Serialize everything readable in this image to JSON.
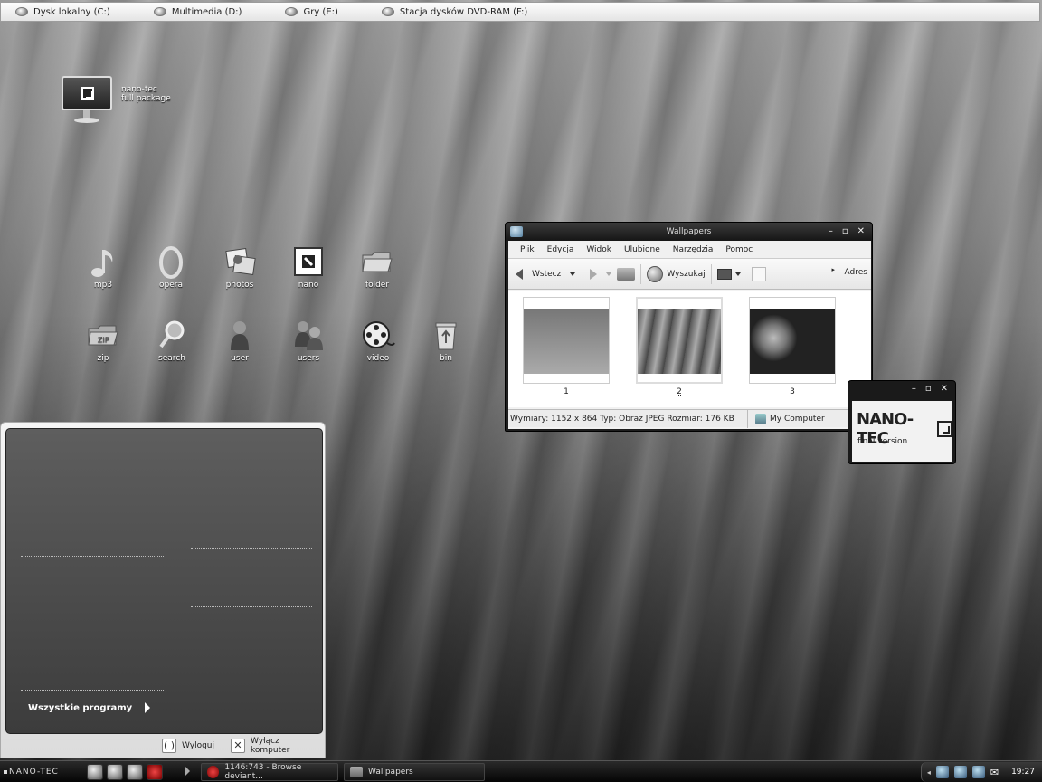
{
  "drives": [
    {
      "label": "Dysk lokalny (C:)"
    },
    {
      "label": "Multimedia (D:)"
    },
    {
      "label": "Gry (E:)"
    },
    {
      "label": "Stacja dysków DVD-RAM (F:)"
    }
  ],
  "desktop": {
    "package": {
      "line1": "nano-tec",
      "line2": "full package"
    },
    "row1": [
      {
        "label": "mp3",
        "icon": "music-note-icon"
      },
      {
        "label": "opera",
        "icon": "opera-icon"
      },
      {
        "label": "photos",
        "icon": "photos-icon"
      },
      {
        "label": "nano",
        "icon": "nano-icon"
      },
      {
        "label": "folder",
        "icon": "folder-icon"
      }
    ],
    "row2": [
      {
        "label": "zip",
        "icon": "zip-folder-icon"
      },
      {
        "label": "search",
        "icon": "search-icon"
      },
      {
        "label": "user",
        "icon": "user-icon"
      },
      {
        "label": "users",
        "icon": "users-icon"
      },
      {
        "label": "video",
        "icon": "film-reel-icon"
      },
      {
        "label": "bin",
        "icon": "recycle-bin-icon"
      }
    ]
  },
  "start_menu": {
    "all_programs": "Wszystkie programy",
    "logoff": "Wyloguj",
    "shutdown": "Wyłącz komputer"
  },
  "explorer": {
    "title": "Wallpapers",
    "menu": [
      "Plik",
      "Edycja",
      "Widok",
      "Ulubione",
      "Narzędzia",
      "Pomoc"
    ],
    "back": "Wstecz",
    "search": "Wyszukaj",
    "address": "Adres",
    "thumbs": [
      {
        "label": "1"
      },
      {
        "label": "2"
      },
      {
        "label": "3"
      }
    ],
    "status": "Wymiary: 1152 x 864 Typ: Obraz JPEG Rozmiar: 176 KB",
    "location": "My Computer"
  },
  "badge": {
    "title": "NANO-TEC",
    "subtitle": "final version"
  },
  "taskbar": {
    "start": "NANO-TEC",
    "tasks": [
      {
        "label": "1146:743 - Browse deviant..."
      },
      {
        "label": "Wallpapers"
      }
    ],
    "clock": "19:27"
  }
}
